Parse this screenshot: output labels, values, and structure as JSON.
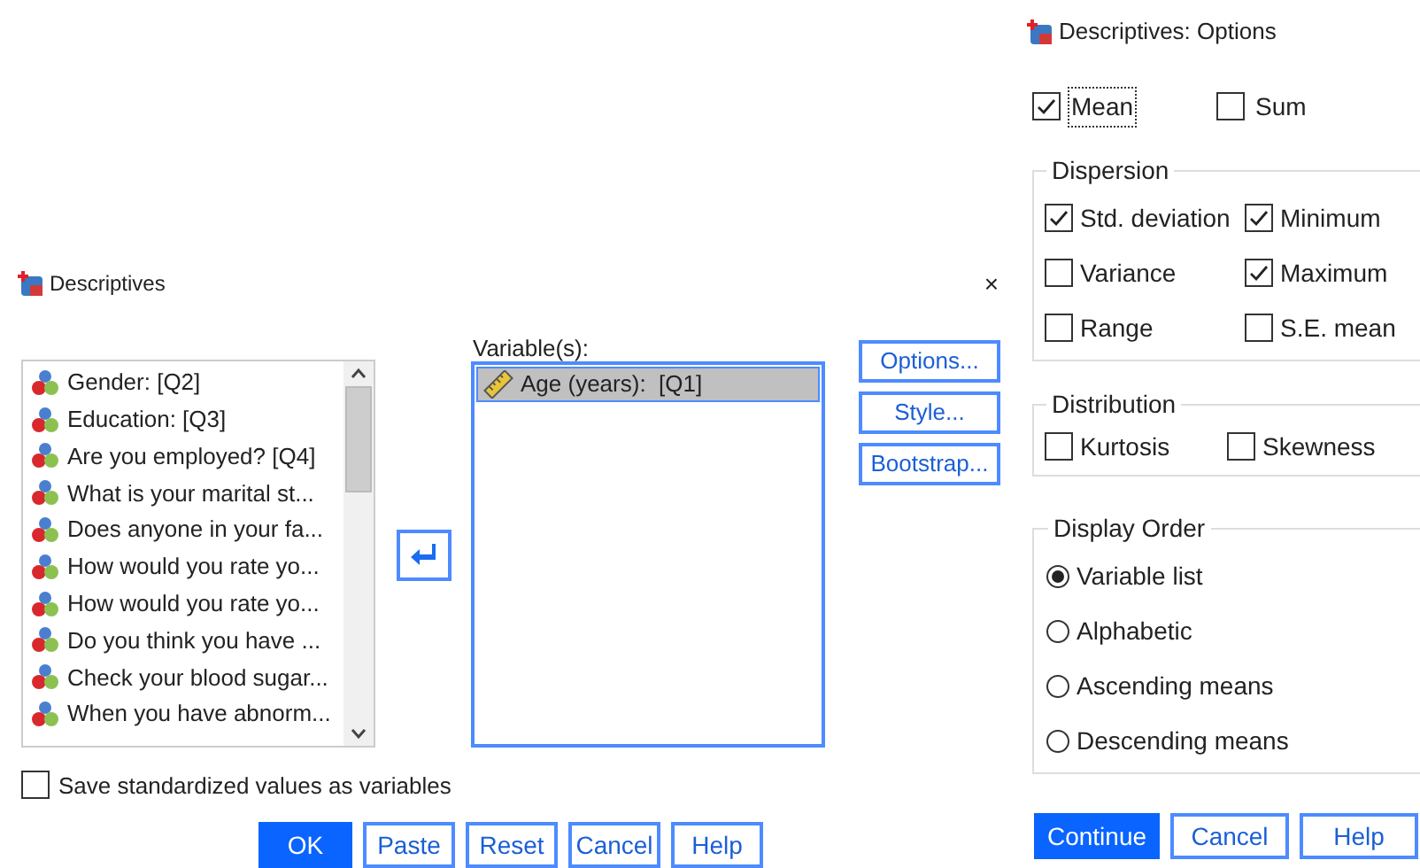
{
  "descriptives_dialog": {
    "title": "Descriptives",
    "close": "×",
    "source_variables": [
      {
        "label": "Gender: [Q2]",
        "kind": "nominal",
        "selected": false
      },
      {
        "label": "Education: [Q3]",
        "kind": "nominal",
        "selected": false
      },
      {
        "label": "Are you employed? [Q4]",
        "kind": "nominal",
        "selected": false
      },
      {
        "label": "What is your marital st...",
        "kind": "nominal",
        "selected": false
      },
      {
        "label": "Does anyone in your fa...",
        "kind": "nominal",
        "selected": false
      },
      {
        "label": "How would you rate yo...",
        "kind": "nominal",
        "selected": false
      },
      {
        "label": "How would you rate yo...",
        "kind": "nominal",
        "selected": false
      },
      {
        "label": "Do you think you have ...",
        "kind": "nominal",
        "selected": false
      },
      {
        "label": "Check your blood sugar...",
        "kind": "nominal",
        "selected": false
      },
      {
        "label": "When you have abnorm...",
        "kind": "nominal",
        "selected": false
      }
    ],
    "variables_label": "Variable(s):",
    "target_variables": [
      {
        "label": "Age (years):  [Q1]",
        "kind": "scale",
        "selected": true
      }
    ],
    "side_buttons": [
      "Options...",
      "Style...",
      "Bootstrap..."
    ],
    "save_standardized": {
      "label": "Save standardized values as variables",
      "checked": false
    },
    "buttons": [
      {
        "label": "OK",
        "default": true
      },
      {
        "label": "Paste",
        "default": false
      },
      {
        "label": "Reset",
        "default": false
      },
      {
        "label": "Cancel",
        "default": false
      },
      {
        "label": "Help",
        "default": false
      }
    ]
  },
  "options_dialog": {
    "title": "Descriptives: Options",
    "top_options": [
      {
        "label": "Mean",
        "checked": true,
        "focused": true
      },
      {
        "label": "Sum",
        "checked": false,
        "focused": false
      }
    ],
    "dispersion": {
      "title": "Dispersion",
      "options": [
        {
          "label": "Std. deviation",
          "checked": true
        },
        {
          "label": "Minimum",
          "checked": true
        },
        {
          "label": "Variance",
          "checked": false
        },
        {
          "label": "Maximum",
          "checked": true
        },
        {
          "label": "Range",
          "checked": false
        },
        {
          "label": "S.E. mean",
          "checked": false
        }
      ]
    },
    "distribution": {
      "title": "Distribution",
      "options": [
        {
          "label": "Kurtosis",
          "checked": false
        },
        {
          "label": "Skewness",
          "checked": false
        }
      ]
    },
    "display_order": {
      "title": "Display Order",
      "options": [
        {
          "label": "Variable list",
          "selected": true
        },
        {
          "label": "Alphabetic",
          "selected": false
        },
        {
          "label": "Ascending means",
          "selected": false
        },
        {
          "label": "Descending means",
          "selected": false
        }
      ]
    },
    "buttons": [
      {
        "label": "Continue",
        "default": true
      },
      {
        "label": "Cancel",
        "default": false
      },
      {
        "label": "Help",
        "default": false
      }
    ]
  }
}
